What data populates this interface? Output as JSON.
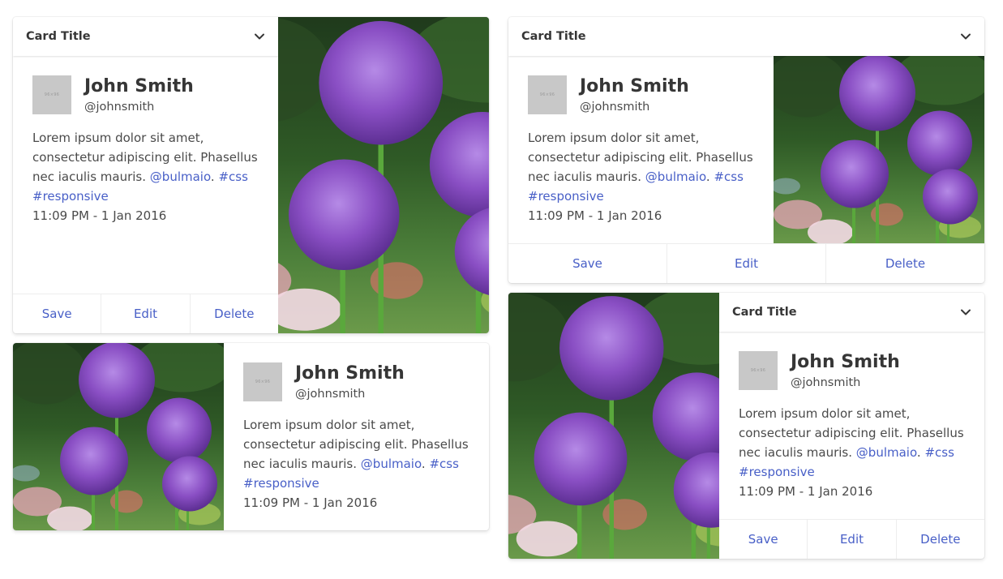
{
  "cards": [
    {
      "header_title": "Card Title",
      "name": "John Smith",
      "handle": "@johnsmith",
      "avatar_label": "96×96",
      "body": "Lorem ipsum dolor sit amet, consectetur adipiscing elit. Phasellus nec iaculis mauris.",
      "mention": "@bulmaio",
      "separator": ".",
      "tag1": "#css",
      "tag2": "#responsive",
      "time": "11:09 PM - 1 Jan 2016",
      "footer": [
        "Save",
        "Edit",
        "Delete"
      ]
    },
    {
      "header_title": "Card Title",
      "name": "John Smith",
      "handle": "@johnsmith",
      "avatar_label": "96×96",
      "body": "Lorem ipsum dolor sit amet, consectetur adipiscing elit. Phasellus nec iaculis mauris.",
      "mention": "@bulmaio",
      "separator": ".",
      "tag1": "#css",
      "tag2": "#responsive",
      "time": "11:09 PM - 1 Jan 2016",
      "footer": [
        "Save",
        "Edit",
        "Delete"
      ]
    },
    {
      "name": "John Smith",
      "handle": "@johnsmith",
      "avatar_label": "96×96",
      "body": "Lorem ipsum dolor sit amet, consectetur adipiscing elit. Phasellus nec iaculis mauris.",
      "mention": "@bulmaio",
      "separator": ".",
      "tag1": "#css",
      "tag2": "#responsive",
      "time": "11:09 PM - 1 Jan 2016"
    },
    {
      "header_title": "Card Title",
      "name": "John Smith",
      "handle": "@johnsmith",
      "avatar_label": "96×96",
      "body": "Lorem ipsum dolor sit amet, consectetur adipiscing elit. Phasellus nec iaculis mauris.",
      "mention": "@bulmaio",
      "separator": ".",
      "tag1": "#css",
      "tag2": "#responsive",
      "time": "11:09 PM - 1 Jan 2016",
      "footer": [
        "Save",
        "Edit",
        "Delete"
      ]
    }
  ],
  "colors": {
    "link": "#485fc7",
    "title": "#363636",
    "text": "#4a4a4a",
    "avatar_placeholder": "#c8c8c8",
    "flower": "#8a4fc4",
    "stem": "#5aa83c"
  },
  "icons": {
    "header_toggle": "chevron-down-icon",
    "photo": "allium-flowers-photo"
  }
}
